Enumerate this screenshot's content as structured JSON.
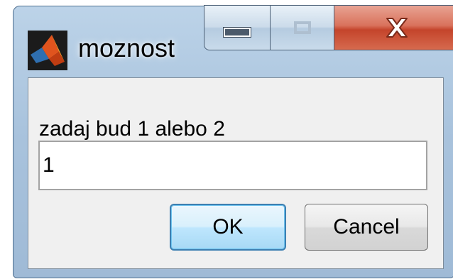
{
  "window": {
    "title": "moznost",
    "app_icon": "matlab-logo-icon",
    "caption_buttons": {
      "minimize_icon": "minimize-icon",
      "maximize_icon": "maximize-icon",
      "close_icon": "close-x-icon"
    }
  },
  "dialog": {
    "prompt": "zadaj bud 1 alebo 2",
    "input_value": "1",
    "ok_label": "OK",
    "cancel_label": "Cancel"
  },
  "colors": {
    "frame": "#a9c3dd",
    "close_button": "#c4442b",
    "default_button_border": "#3c7fb1",
    "client_background": "#f0f0f0"
  }
}
